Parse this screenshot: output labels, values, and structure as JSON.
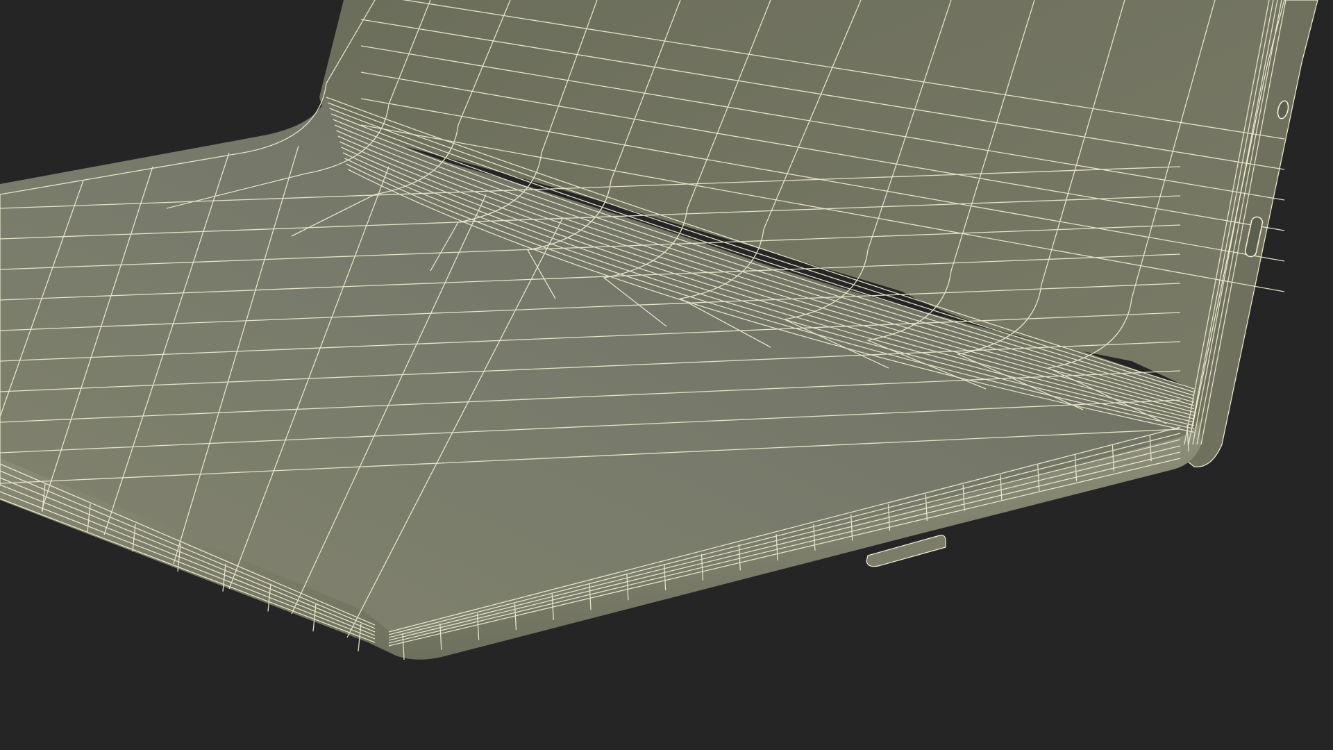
{
  "scene": {
    "subject": "foldable-device-wireframe",
    "colors": {
      "background": "#252525",
      "surface_light": "#83856f",
      "surface_mid": "#73745f",
      "surface_dark": "#666857",
      "edge_light": "#8a8c77",
      "wire": "#f1efd5",
      "port_fill": "#5c5e4e"
    }
  }
}
